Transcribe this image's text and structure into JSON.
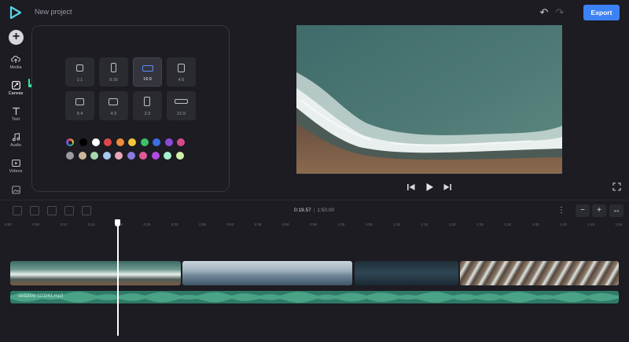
{
  "header": {
    "project_title": "New project",
    "export_label": "Export"
  },
  "sidebar": {
    "items": [
      {
        "label": "Media",
        "icon": "cloud-upload-icon"
      },
      {
        "label": "Canvas",
        "icon": "canvas-icon"
      },
      {
        "label": "Text",
        "icon": "text-icon"
      },
      {
        "label": "Audio",
        "icon": "music-note-icon"
      },
      {
        "label": "Videos",
        "icon": "video-icon"
      },
      {
        "label": "",
        "icon": "image-icon"
      }
    ],
    "active": "Canvas"
  },
  "canvas_panel": {
    "ratios": [
      "1:1",
      "9:16",
      "16:9",
      "4:5",
      "5:4",
      "4:3",
      "2:3",
      "21:9"
    ],
    "selected_ratio": "16:9",
    "colors_row1": [
      "#000000",
      "#ffffff",
      "#e04848",
      "#f08a3c",
      "#f2c438",
      "#3cc06a",
      "#3a6fe0",
      "#8a4ad8",
      "#d64a8c"
    ],
    "colors_row2": [
      "#9a9aa2",
      "#cbb89a",
      "#a9d6b0",
      "#a8c8ee",
      "#e6a8b8",
      "#8a7ae0",
      "#e05a9a",
      "#b04ae0",
      "#a8f0d0",
      "#d0f0a8"
    ]
  },
  "player": {
    "current_time": "0:19.57",
    "total_time": "1:50.00"
  },
  "timeline": {
    "ruler_labels": [
      "0:00",
      "0:05",
      "0:10",
      "0:15",
      "0:20",
      "0:25",
      "0:30",
      "0:35",
      "0:40",
      "0:45",
      "0:50",
      "0:55",
      "1:00",
      "1:05",
      "1:10",
      "1:15",
      "1:20",
      "1:25",
      "1:30",
      "1:35",
      "1:40",
      "1:45",
      "1:50"
    ],
    "audio_track_name": "sedative-110241.mp3",
    "playhead_time": "0:19.57"
  }
}
